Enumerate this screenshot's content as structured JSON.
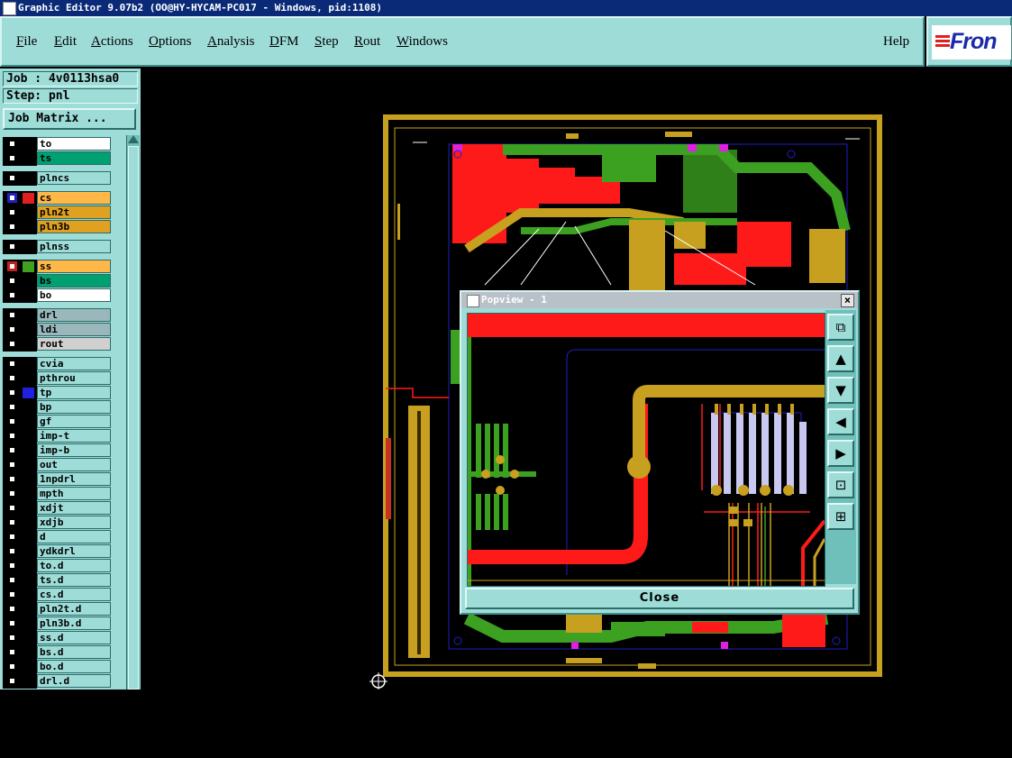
{
  "window": {
    "title": "Graphic Editor 9.07b2 (OO@HY-HYCAM-PC017 - Windows, pid:1108)"
  },
  "menu": {
    "items": [
      "File",
      "Edit",
      "Actions",
      "Options",
      "Analysis",
      "DFM",
      "Step",
      "Rout",
      "Windows"
    ],
    "help": "Help",
    "logo": "Fron"
  },
  "job": {
    "job_label": "Job : 4v0113hsa0",
    "step_label": "Step: pnl",
    "matrix_button": "Job Matrix ..."
  },
  "layers": [
    {
      "name": "to",
      "color": "#ffffff",
      "swatch": "#000000"
    },
    {
      "name": "ts",
      "color": "#00a070",
      "swatch": "#000000"
    },
    {
      "name": "plncs",
      "color": "#9edcd8",
      "swatch": "#000000"
    },
    {
      "name": "cs",
      "color": "#ffb848",
      "swatch": "#e02020",
      "active": true
    },
    {
      "name": "pln2t",
      "color": "#e0a020",
      "swatch": "#000000"
    },
    {
      "name": "pln3b",
      "color": "#e0a020",
      "swatch": "#000000"
    },
    {
      "name": "plnss",
      "color": "#9edcd8",
      "swatch": "#000000"
    },
    {
      "name": "ss",
      "color": "#ffb848",
      "swatch": "#40a020",
      "marked": true
    },
    {
      "name": "bs",
      "color": "#00a070",
      "swatch": "#000000"
    },
    {
      "name": "bo",
      "color": "#ffffff",
      "swatch": "#000000"
    },
    {
      "name": "drl",
      "color": "#9ab8bc",
      "swatch": "#000000"
    },
    {
      "name": "ldi",
      "color": "#9ab8bc",
      "swatch": "#000000"
    },
    {
      "name": "rout",
      "color": "#d0d0d0",
      "swatch": "#000000"
    },
    {
      "name": "cvia",
      "color": "#9edcd8",
      "swatch": "#000000"
    },
    {
      "name": "pthrou",
      "color": "#9edcd8",
      "swatch": "#000000"
    },
    {
      "name": "tp",
      "color": "#9edcd8",
      "swatch": "#2020e0"
    },
    {
      "name": "bp",
      "color": "#9edcd8",
      "swatch": "#000000"
    },
    {
      "name": "gf",
      "color": "#9edcd8",
      "swatch": "#000000"
    },
    {
      "name": "imp-t",
      "color": "#9edcd8",
      "swatch": "#000000"
    },
    {
      "name": "imp-b",
      "color": "#9edcd8",
      "swatch": "#000000"
    },
    {
      "name": "out",
      "color": "#9edcd8",
      "swatch": "#000000"
    },
    {
      "name": "1npdrl",
      "color": "#9edcd8",
      "swatch": "#000000"
    },
    {
      "name": "mpth",
      "color": "#9edcd8",
      "swatch": "#000000"
    },
    {
      "name": "xdjt",
      "color": "#9edcd8",
      "swatch": "#000000"
    },
    {
      "name": "xdjb",
      "color": "#9edcd8",
      "swatch": "#000000"
    },
    {
      "name": "d",
      "color": "#9edcd8",
      "swatch": "#000000"
    },
    {
      "name": "ydkdrl",
      "color": "#9edcd8",
      "swatch": "#000000"
    },
    {
      "name": "to.d",
      "color": "#9edcd8",
      "swatch": "#000000"
    },
    {
      "name": "ts.d",
      "color": "#9edcd8",
      "swatch": "#000000"
    },
    {
      "name": "cs.d",
      "color": "#9edcd8",
      "swatch": "#000000"
    },
    {
      "name": "pln2t.d",
      "color": "#9edcd8",
      "swatch": "#000000"
    },
    {
      "name": "pln3b.d",
      "color": "#9edcd8",
      "swatch": "#000000"
    },
    {
      "name": "ss.d",
      "color": "#9edcd8",
      "swatch": "#000000"
    },
    {
      "name": "bs.d",
      "color": "#9edcd8",
      "swatch": "#000000"
    },
    {
      "name": "bo.d",
      "color": "#9edcd8",
      "swatch": "#000000"
    },
    {
      "name": "drl.d",
      "color": "#9edcd8",
      "swatch": "#000000"
    }
  ],
  "popview": {
    "title": "Popview - 1",
    "close_label": "Close",
    "tools": [
      "zoom-fit-icon",
      "pan-up-icon",
      "pan-down-icon",
      "pan-left-icon",
      "pan-right-icon",
      "zoom-out-icon",
      "zoom-in-icon"
    ]
  },
  "colors": {
    "panel": "#9edcd8",
    "copper_red": "#ff1a1a",
    "copper_gold": "#c8a020",
    "mask_green": "#3ca020",
    "outline_blue": "#2020c0",
    "pad_lavender": "#c8c8f0"
  }
}
